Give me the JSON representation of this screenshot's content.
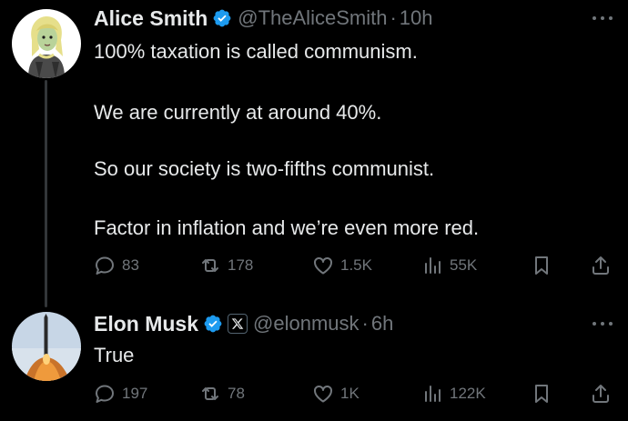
{
  "tweets": [
    {
      "author": {
        "name": "Alice Smith",
        "handle": "@TheAliceSmith",
        "time": "10h",
        "verified": true,
        "avatar": "cartoon-blonde-woman-avatar"
      },
      "lines": [
        "100% taxation is called communism.",
        "We are currently at around 40%.",
        "So our society is two-fifths communist.",
        "Factor in inflation and we’re even more red."
      ],
      "actions": {
        "replies": "83",
        "reposts": "178",
        "likes": "1.5K",
        "views": "55K"
      }
    },
    {
      "author": {
        "name": "Elon Musk",
        "handle": "@elonmusk",
        "time": "6h",
        "verified": true,
        "affiliation": "x-logo-badge",
        "avatar": "rocket-launch-avatar"
      },
      "lines": [
        "True"
      ],
      "actions": {
        "replies": "197",
        "reposts": "78",
        "likes": "1K",
        "views": "122K"
      }
    }
  ],
  "separator": "·",
  "colors": {
    "background": "#000000",
    "text": "#e7e9ea",
    "muted": "#71767b",
    "verified": "#1d9bf0",
    "thread_line": "#333639"
  }
}
